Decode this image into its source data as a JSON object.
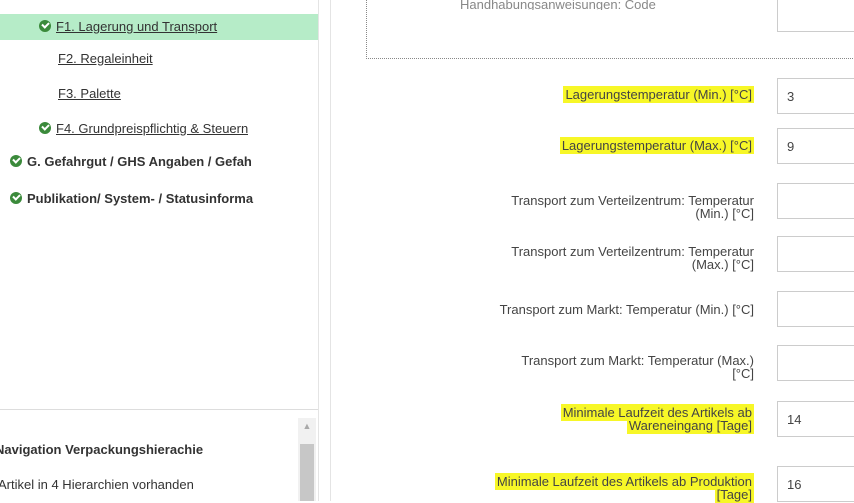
{
  "nav": {
    "items": [
      {
        "label": "F1. Lagerung und Transport",
        "checked": true,
        "active": true
      },
      {
        "label": "F2. Regaleinheit",
        "checked": false
      },
      {
        "label": "F3. Palette",
        "checked": false
      },
      {
        "label": "F4. Grundpreispflichtig & Steuern",
        "checked": true
      },
      {
        "label": "G. Gefahrgut / GHS Angaben / Gefah",
        "checked": true,
        "bold": true
      },
      {
        "label": "Publikation/ System- / Statusinforma",
        "checked": true,
        "bold": true
      }
    ],
    "hierarchy_title": "Navigation Verpackungshierachie",
    "hierarchy_text": "Artikel in 4 Hierarchien vorhanden"
  },
  "form": {
    "cut_label": "Handhabungsanweisungen: Code",
    "fields": [
      {
        "label_lines": [
          "Lagerungstemperatur (Min.) [°C]"
        ],
        "value": "3",
        "highlight": true
      },
      {
        "label_lines": [
          "Lagerungstemperatur (Max.) [°C]"
        ],
        "value": "9",
        "highlight": true
      },
      {
        "label_lines": [
          "Transport zum Verteilzentrum: Temperatur",
          "(Min.) [°C]"
        ],
        "value": "",
        "highlight": false
      },
      {
        "label_lines": [
          "Transport zum Verteilzentrum: Temperatur",
          "(Max.) [°C]"
        ],
        "value": "",
        "highlight": false
      },
      {
        "label_lines": [
          "Transport zum Markt: Temperatur (Min.) [°C]"
        ],
        "value": "",
        "highlight": false
      },
      {
        "label_lines": [
          "Transport zum Markt: Temperatur (Max.)",
          "[°C]"
        ],
        "value": "",
        "highlight": false
      },
      {
        "label_lines": [
          "Minimale Laufzeit des Artikels ab",
          "Wareneingang [Tage]"
        ],
        "value": "14",
        "highlight": true
      },
      {
        "label_lines": [
          "Minimale Laufzeit des Artikels ab Produktion",
          "[Tage]"
        ],
        "value": "16",
        "highlight": true
      }
    ]
  },
  "colors": {
    "active_bg": "#b6ecc8",
    "check_green": "#3b8a3b",
    "highlight": "#f7f727"
  }
}
